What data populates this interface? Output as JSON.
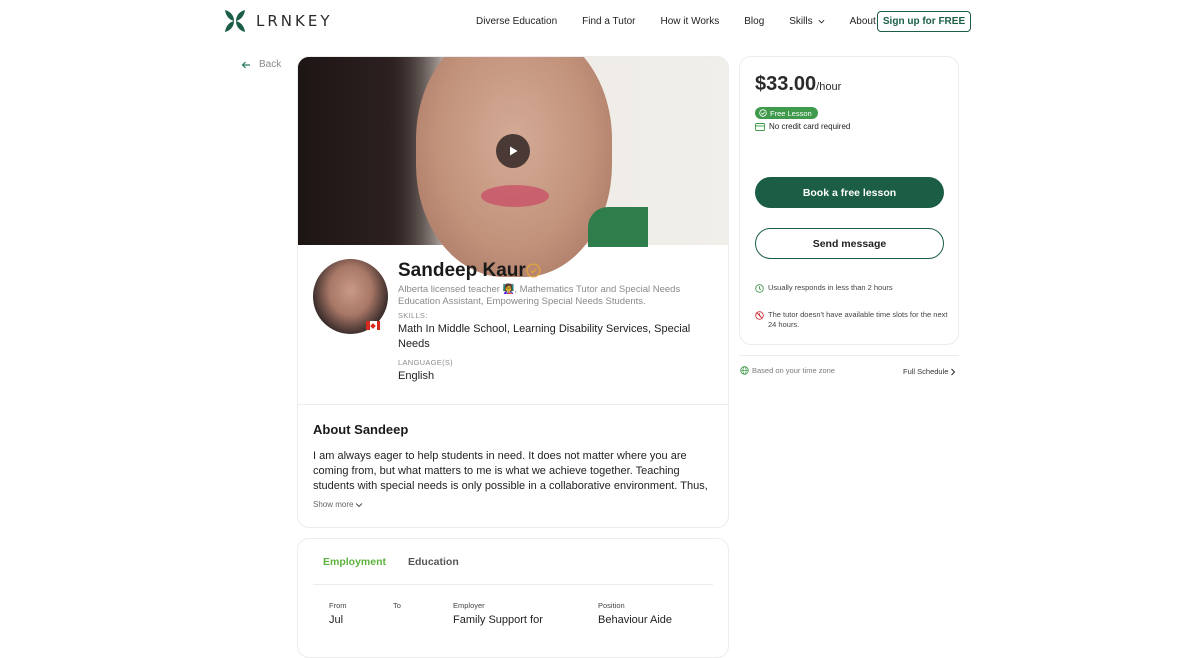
{
  "brand": {
    "name": "LRNKEY",
    "color": "#1b5e45"
  },
  "nav": {
    "items": [
      "Diverse Education",
      "Find a Tutor",
      "How it Works",
      "Blog",
      "Skills",
      "About"
    ],
    "signup_label": "Sign up for FREE"
  },
  "back_label": "Back",
  "tutor": {
    "name": "Sandeep Kaur",
    "headline": "Alberta licensed teacher 👩‍🏫, Mathematics Tutor and Special Needs Education Assistant, Empowering Special Needs Students.",
    "skills_label": "SKILLS:",
    "skills": "Math In Middle School, Learning Disability Services, Special Needs",
    "languages_label": "LANGUAGE(S)",
    "languages": "English"
  },
  "about": {
    "title": "About Sandeep",
    "text": "I am always eager to help students in need. It does not matter where you are coming from, but what matters to me is what we achieve together. Teaching students with special needs is only possible in a collaborative environment. Thus,",
    "show_more": "Show more"
  },
  "employment": {
    "tabs": [
      "Employment",
      "Education"
    ],
    "active_tab_color": "#5cb23d",
    "headers": [
      "From",
      "To",
      "Employer",
      "Position"
    ],
    "row": {
      "from": "Jul",
      "to": "",
      "employer": "Family Support for",
      "position": "Behaviour Aide"
    }
  },
  "pricing": {
    "amount": "$33.00",
    "unit": "/hour",
    "free_badge": "Free Lesson",
    "no_card": "No credit card required",
    "book_label": "Book a free lesson",
    "message_label": "Send message",
    "responds": "Usually responds in less than 2 hours",
    "no_slots": "The tutor doesn't have available time slots for the next 24 hours."
  },
  "schedule": {
    "timezone_note": "Based on your time zone",
    "full_schedule": "Full Schedule"
  },
  "icons": [
    "leaf-logo-icon",
    "chevron-down-icon",
    "arrow-left-icon",
    "play-icon",
    "verified-badge-icon",
    "canada-flag-icon",
    "check-circle-icon",
    "credit-card-icon",
    "clock-icon",
    "calendar-off-icon",
    "globe-icon",
    "chevron-right-icon"
  ]
}
